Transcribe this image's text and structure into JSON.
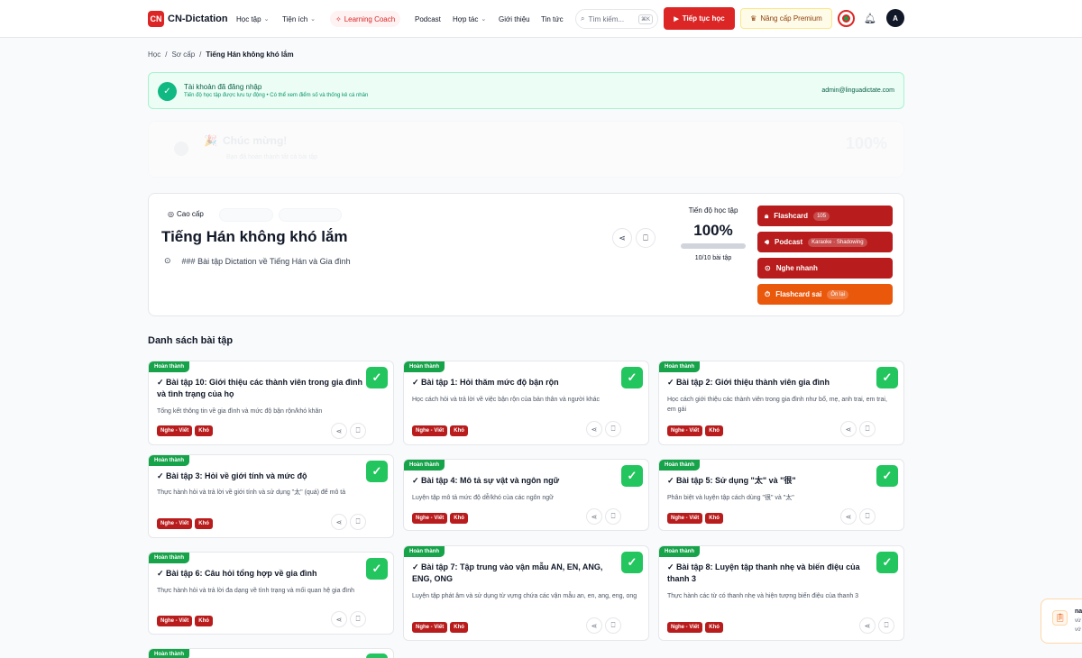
{
  "nav": {
    "logo_mark": "CN",
    "logo": "CN-Dictation",
    "items": [
      "Học tập",
      "Tiện ích",
      "Learning Coach",
      "Podcast",
      "Hợp tác",
      "Giới thiệu",
      "Tin tức"
    ],
    "search_placeholder": "Tìm kiếm...",
    "search_kbd": "⌘K",
    "continue_btn": "Tiếp tục học",
    "premium_btn": "Nâng cấp Premium",
    "avatar": "A"
  },
  "breadcrumb": [
    "Học",
    "Sơ cấp",
    "Tiếng Hán không khó lắm"
  ],
  "login_banner": {
    "title": "Tài khoản đã đăng nhập",
    "subtitle": "Tiến độ học tập được lưu tự động • Có thể xem điểm số và thống kê cá nhân",
    "email": "admin@linguadictate.com"
  },
  "congrats": {
    "title": "Chúc mừng!",
    "subtitle": "Bạn đã hoàn thành tất cả bài tập",
    "percent": "100%"
  },
  "hero": {
    "level": "Cao cấp",
    "title": "Tiếng Hán không khó lắm",
    "description": "### Bài tập Dictation về Tiếng Hán và Gia đình",
    "progress_label": "Tiến độ học tập",
    "progress_value": "100%",
    "progress_fraction": 1.0,
    "progress_count": "10/10 bài tập",
    "actions": [
      {
        "label": "Flashcard",
        "badge": "105",
        "color": "#b91c1c"
      },
      {
        "label": "Podcast",
        "badge": "Karaoke · Shadowing",
        "color": "#b91c1c"
      },
      {
        "label": "Nghe nhanh",
        "badge": "",
        "color": "#b91c1c"
      },
      {
        "label": "Flashcard sai",
        "badge": "Ôn lại",
        "color": "#ea580c"
      }
    ]
  },
  "section_title": "Danh sách bài tập",
  "cards": [
    {
      "status": "Hoàn thành",
      "title": "✓ Bài tập 10: Giới thiệu các thành viên trong gia đình và tình trạng của họ",
      "desc": "Tổng kết thông tin về gia đình và mức độ bận rộn/khó khăn",
      "tags": [
        "Nghe - Viết",
        "Khó"
      ]
    },
    {
      "status": "Hoàn thành",
      "title": "✓ Bài tập 1: Hỏi thăm mức độ bận rộn",
      "desc": "Học cách hỏi và trả lời về việc bận rộn của bản thân và người khác",
      "tags": [
        "Nghe - Viết",
        "Khó"
      ]
    },
    {
      "status": "Hoàn thành",
      "title": "✓ Bài tập 2: Giới thiệu thành viên gia đình",
      "desc": "Học cách giới thiệu các thành viên trong gia đình như bố, mẹ, anh trai, em trai, em gái",
      "tags": [
        "Nghe - Viết",
        "Khó"
      ]
    },
    {
      "status": "Hoàn thành",
      "title": "✓ Bài tập 3: Hỏi về giới tính và mức độ",
      "desc": "Thực hành hỏi và trả lời về giới tính và sử dụng \"太\" (quá) để mô tả",
      "tags": [
        "Nghe - Viết",
        "Khó"
      ]
    },
    {
      "status": "Hoàn thành",
      "title": "✓ Bài tập 4: Mô tả sự vật và ngôn ngữ",
      "desc": "Luyện tập mô tả mức độ dễ/khó của các ngôn ngữ",
      "tags": [
        "Nghe - Viết",
        "Khó"
      ]
    },
    {
      "status": "Hoàn thành",
      "title": "✓ Bài tập 5: Sử dụng \"太\" và \"很\"",
      "desc": "Phân biệt và luyện tập cách dùng \"很\" và \"太\"",
      "tags": [
        "Nghe - Viết",
        "Khó"
      ]
    },
    {
      "status": "Hoàn thành",
      "title": "✓ Bài tập 6: Câu hỏi tổng hợp về gia đình",
      "desc": "Thực hành hỏi và trả lời đa dạng về tình trạng và mối quan hệ gia đình",
      "tags": [
        "Nghe - Viết",
        "Khó"
      ]
    },
    {
      "status": "Hoàn thành",
      "title": "✓ Bài tập 7: Tập trung vào vận mẫu AN, EN, ANG, ENG, ONG",
      "desc": "Luyện tập phát âm và sử dụng từ vựng chứa các vận mẫu an, en, ang, eng, ong",
      "tags": [
        "Nghe - Viết",
        "Khó"
      ]
    },
    {
      "status": "Hoàn thành",
      "title": "✓ Bài tập 8: Luyện tập thanh nhẹ và biến điệu của thanh 3",
      "desc": "Thực hành các từ có thanh nhẹ và hiện tượng biến điệu của thanh 3",
      "tags": [
        "Nghe - Viết",
        "Khó"
      ]
    },
    {
      "status": "Hoàn thành",
      "title": "",
      "desc": "",
      "tags": []
    }
  ],
  "toast": {
    "title": "na",
    "line1": "vừ",
    "line2": "vớ"
  },
  "colors": {
    "brand_red": "#dc2626",
    "success": "#22c55e",
    "tag_red": "#b91c1c",
    "orange": "#ea580c"
  },
  "icons": [
    "logo-icon",
    "sparkle-icon",
    "search-icon",
    "play-icon",
    "crown-icon",
    "flag-icon",
    "bell-icon",
    "check-circle-icon",
    "shield-check-icon",
    "share-icon",
    "bookmark-icon",
    "lock-icon",
    "volume-icon",
    "play-circle-icon",
    "clock-icon",
    "clipboard-icon"
  ]
}
